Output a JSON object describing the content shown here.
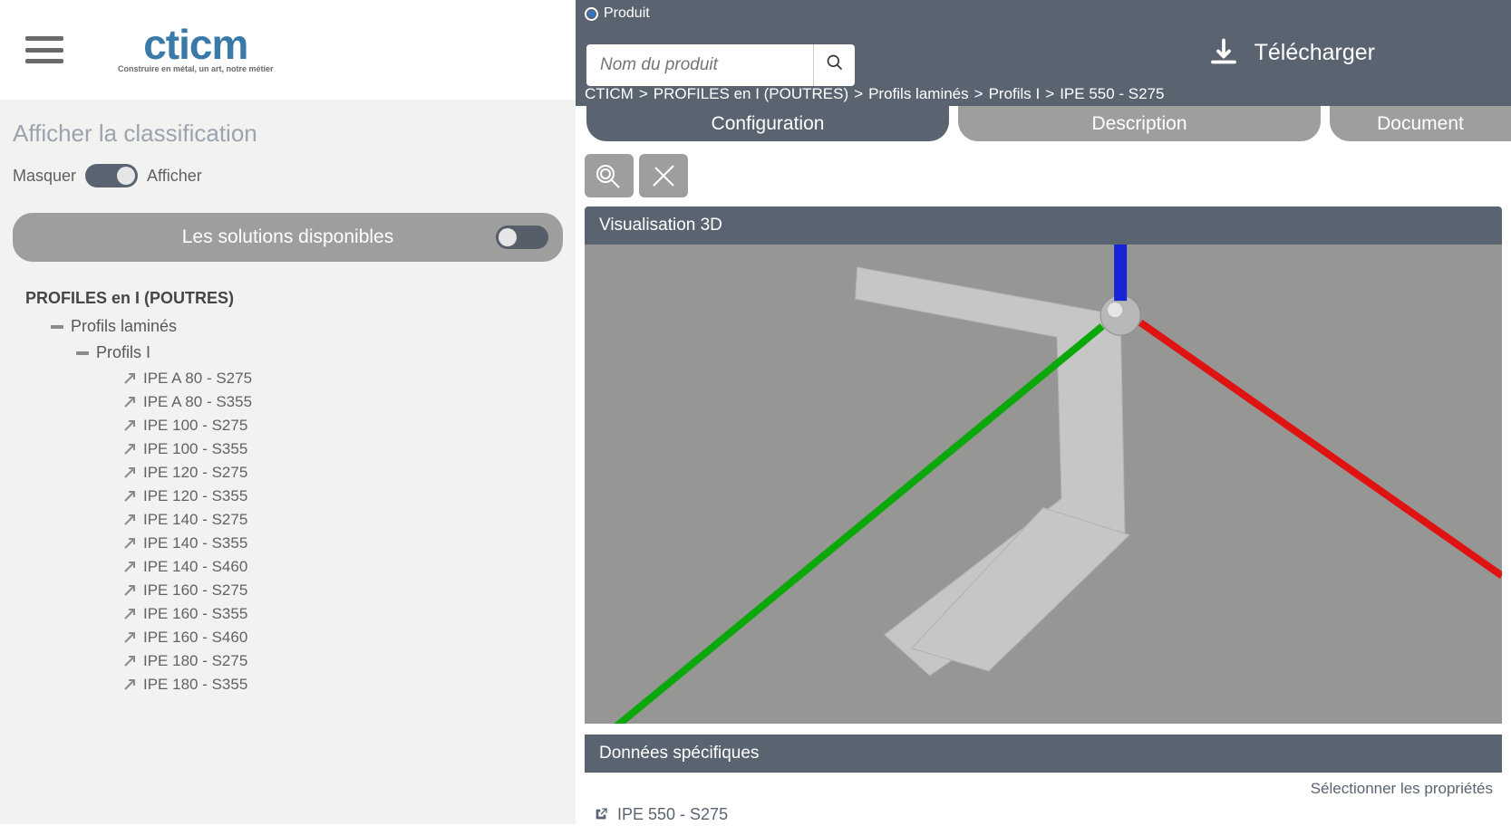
{
  "sidebar": {
    "section_title": "Afficher la classification",
    "hide_label": "Masquer",
    "show_label": "Afficher",
    "solutions_label": "Les solutions disponibles",
    "tree": {
      "root": "PROFILES en I (POUTRES)",
      "level1": "Profils laminés",
      "level2": "Profils I",
      "leaves": [
        "IPE A 80 - S275",
        "IPE A 80 - S355",
        "IPE 100 - S275",
        "IPE 100 - S355",
        "IPE 120 - S275",
        "IPE 120 - S355",
        "IPE 140 - S275",
        "IPE 140 - S355",
        "IPE 140 - S460",
        "IPE 160 - S275",
        "IPE 160 - S355",
        "IPE 160 - S460",
        "IPE 180 - S275",
        "IPE 180 - S355"
      ]
    }
  },
  "logo": {
    "main": "cticm",
    "sub": "Construire en métal, un art, notre métier"
  },
  "header": {
    "radio_label": "Produit",
    "search_placeholder": "Nom du produit",
    "download_label": "Télécharger",
    "breadcrumb": [
      "CTICM",
      "PROFILES en I (POUTRES)",
      "Profils laminés",
      "Profils I",
      "IPE 550 - S275"
    ]
  },
  "tabs": [
    "Configuration",
    "Description",
    "Document"
  ],
  "panels": {
    "vis_title": "Visualisation 3D",
    "data_title": "Données spécifiques",
    "select_props": "Sélectionner les propriétés",
    "product_name": "IPE 550 - S275"
  }
}
